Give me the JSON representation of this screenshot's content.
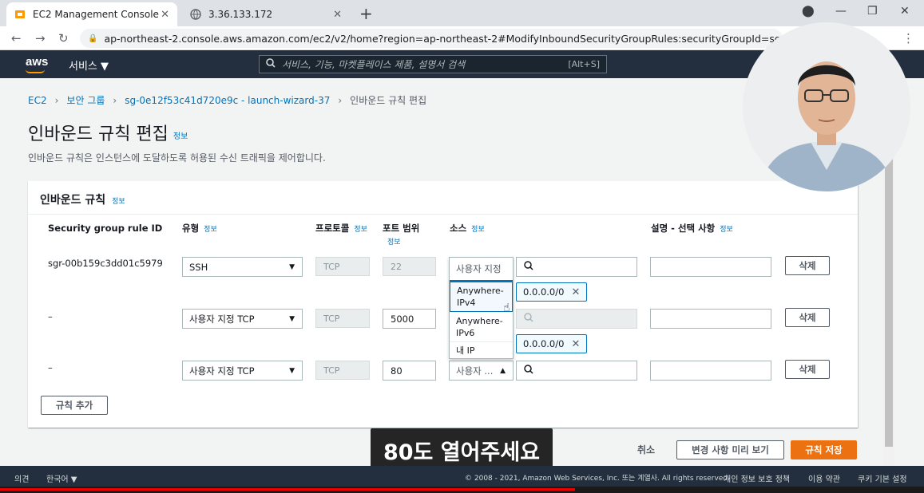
{
  "browser": {
    "tabs": [
      {
        "title": "EC2 Management Console"
      },
      {
        "title": "3.36.133.172"
      }
    ],
    "url": "ap-northeast-2.console.aws.amazon.com/ec2/v2/home?region=ap-northeast-2#ModifyInboundSecurityGroupRules:securityGroupId=sg-0e1..."
  },
  "aws_header": {
    "logo": "aws",
    "services_label": "서비스 ▼",
    "search_placeholder": "서비스, 기능, 마켓플레이스 제품, 설명서 검색",
    "search_shortcut": "[Alt+S]"
  },
  "breadcrumb": {
    "items": [
      "EC2",
      "보안 그룹",
      "sg-0e12f53c41d720e9c - launch-wizard-37"
    ],
    "current": "인바운드 규칙 편집"
  },
  "page": {
    "title": "인바운드 규칙 편집",
    "title_info": "정보",
    "description": "인바운드 규칙은 인스턴스에 도달하도록 허용된 수신 트래픽을 제어합니다."
  },
  "panel": {
    "title": "인바운드 규칙",
    "title_info": "정보",
    "columns": [
      {
        "label": "Security group rule ID",
        "info": ""
      },
      {
        "label": "유형",
        "info": "정보"
      },
      {
        "label": "프로토콜",
        "info": "정보"
      },
      {
        "label": "포트 범위",
        "info": "정보"
      },
      {
        "label": "소스",
        "info": "정보"
      },
      {
        "label": "설명 - 선택 사항",
        "info": "정보"
      }
    ],
    "rows": [
      {
        "rule_id": "sgr-00b159c3dd01c5979",
        "type": "SSH",
        "protocol": "TCP",
        "port": "22",
        "source_select": "사용자 지정",
        "cidr": "0.0.0.0/0",
        "description": "",
        "delete_label": "삭제"
      },
      {
        "rule_id": "–",
        "type": "사용자 지정 TCP",
        "protocol": "TCP",
        "port": "5000",
        "source_select": "",
        "cidr": "0.0.0.0/0",
        "description": "",
        "delete_label": "삭제"
      },
      {
        "rule_id": "–",
        "type": "사용자 지정 TCP",
        "protocol": "TCP",
        "port": "80",
        "source_select": "사용자 ...",
        "cidr": "",
        "description": "",
        "delete_label": "삭제"
      }
    ],
    "dropdown_options": [
      "Anywhere-IPv4",
      "Anywhere-IPv6",
      "내 IP"
    ],
    "add_rule_label": "규칙 추가"
  },
  "actions": {
    "cancel": "취소",
    "preview": "변경 사항 미리 보기",
    "save": "규칙 저장"
  },
  "caption": "80도 열어주세요",
  "footer": {
    "feedback": "의견",
    "language": "한국어 ▼",
    "copyright": "© 2008 - 2021, Amazon Web Services, Inc. 또는 계열사. All rights reserved.",
    "privacy": "개인 정보 보호 정책",
    "terms": "이용 약관",
    "cookies": "쿠키 기본 설정"
  },
  "colors": {
    "aws_dark": "#232f3e",
    "accent_orange": "#ec7211",
    "link_blue": "#0073bb"
  }
}
